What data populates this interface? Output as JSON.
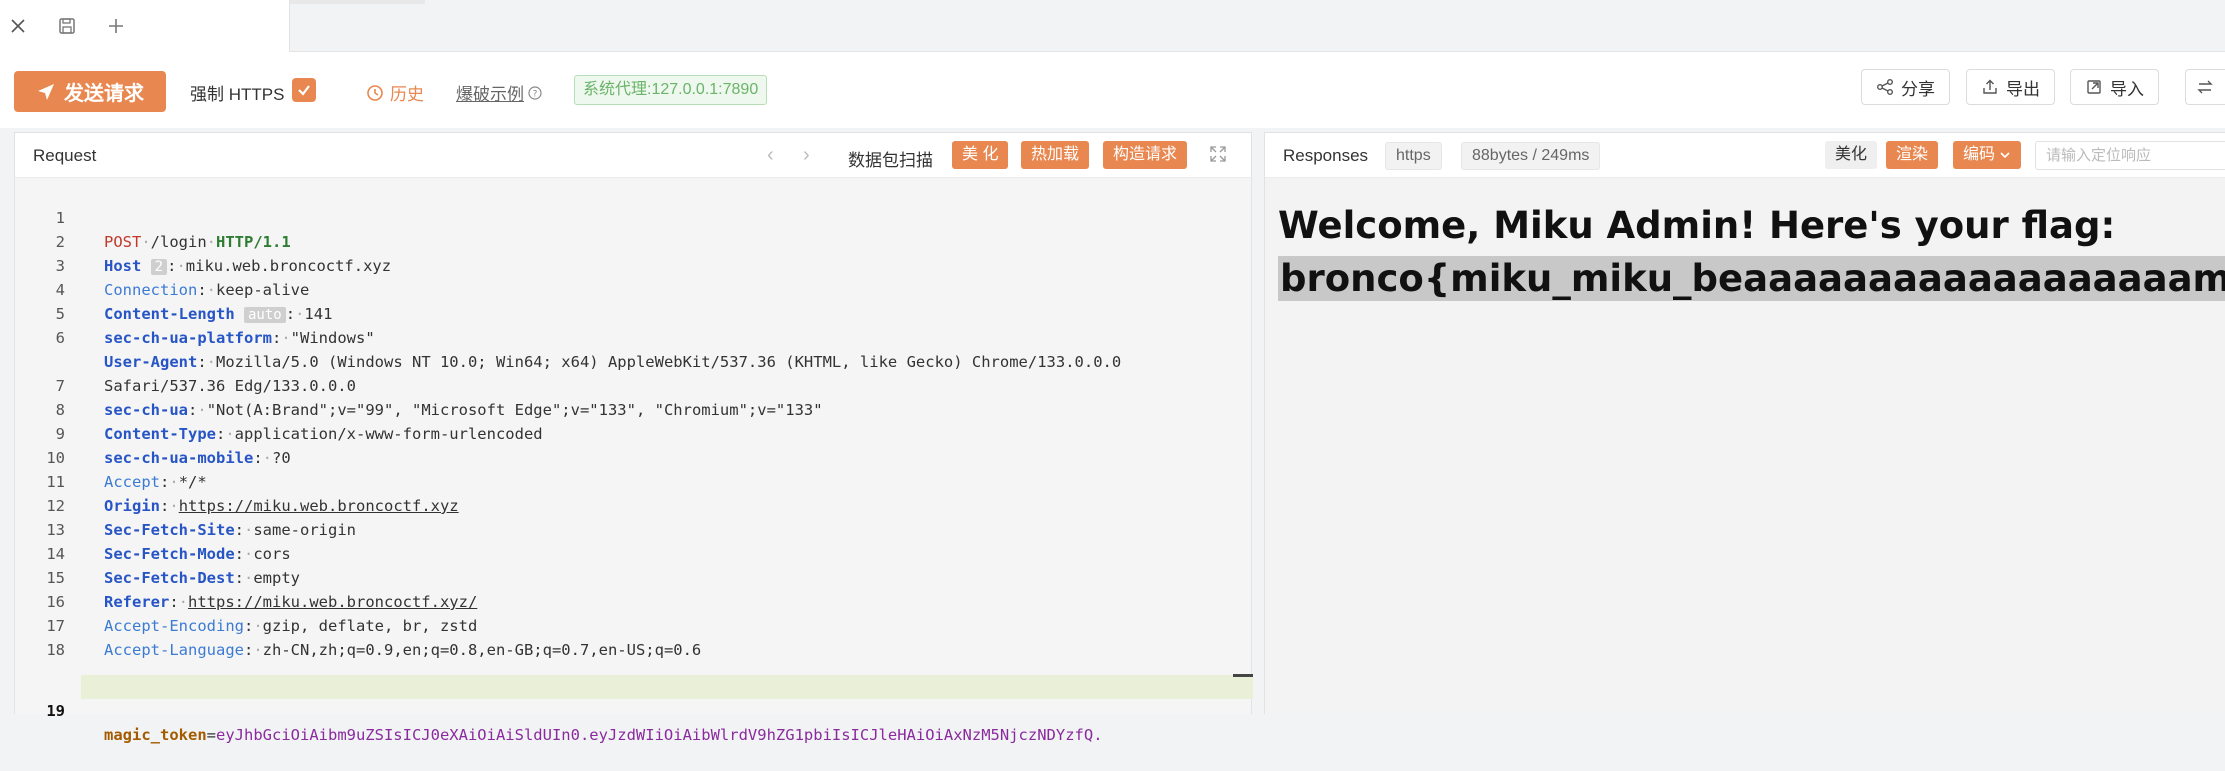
{
  "toolbar": {
    "send_label": "发送请求",
    "https_label": "强制 HTTPS",
    "history_label": "历史",
    "example_label": "爆破示例",
    "proxy_label": "系统代理:127.0.0.1:7890",
    "share_label": "分享",
    "export_label": "导出",
    "import_label": "导入"
  },
  "request": {
    "title": "Request",
    "scan_label": "数据包扫描",
    "beautify_label": "美 化",
    "hotload_label": "热加载",
    "construct_label": "构造请求",
    "lines": [
      {
        "n": "1"
      },
      {
        "n": "2"
      },
      {
        "n": "3"
      },
      {
        "n": "4"
      },
      {
        "n": "5"
      },
      {
        "n": "6"
      },
      {
        "n": ""
      },
      {
        "n": "7"
      },
      {
        "n": "8"
      },
      {
        "n": "9"
      },
      {
        "n": "10"
      },
      {
        "n": "11"
      },
      {
        "n": "12"
      },
      {
        "n": "13"
      },
      {
        "n": "14"
      },
      {
        "n": "15"
      },
      {
        "n": "16"
      },
      {
        "n": "17"
      },
      {
        "n": "18"
      },
      {
        "n": "19"
      }
    ],
    "code": {
      "l1_method": "POST",
      "l1_path": "/login",
      "l1_ver": "HTTP/1.1",
      "l2_key": "Host",
      "l2_pill": "2",
      "l2_val": "miku.web.broncoctf.xyz",
      "l3_key": "Connection",
      "l3_val": "keep-alive",
      "l4_key": "Content-Length",
      "l4_pill": "auto",
      "l4_val": "141",
      "l5_key": "sec-ch-ua-platform",
      "l5_val": "\"Windows\"",
      "l6_key": "User-Agent",
      "l6_val": "Mozilla/5.0 (Windows NT 10.0; Win64; x64) AppleWebKit/537.36 (KHTML, like Gecko) Chrome/133.0.0.0",
      "l6b_val": "Safari/537.36 Edg/133.0.0.0",
      "l7_key": "sec-ch-ua",
      "l7_val": "\"Not(A:Brand\";v=\"99\", \"Microsoft Edge\";v=\"133\", \"Chromium\";v=\"133\"",
      "l8_key": "Content-Type",
      "l8_val": "application/x-www-form-urlencoded",
      "l9_key": "sec-ch-ua-mobile",
      "l9_val": "?0",
      "l10_key": "Accept",
      "l10_val": "*/*",
      "l11_key": "Origin",
      "l11_val": "https://miku.web.broncoctf.xyz",
      "l12_key": "Sec-Fetch-Site",
      "l12_val": "same-origin",
      "l13_key": "Sec-Fetch-Mode",
      "l13_val": "cors",
      "l14_key": "Sec-Fetch-Dest",
      "l14_val": "empty",
      "l15_key": "Referer",
      "l15_val": "https://miku.web.broncoctf.xyz/",
      "l16_key": "Accept-Encoding",
      "l16_val": "gzip, deflate, br, zstd",
      "l17_key": "Accept-Language",
      "l17_val": "zh-CN,zh;q=0.9,en;q=0.8,en-GB;q=0.7,en-US;q=0.6",
      "l19_key": "magic_token",
      "l19_val": "eyJhbGciOiAibm9uZSIsICJ0eXAiOiAiSldUIn0.eyJzdWIiOiAibWlrdV9hZG1pbiIsICJleHAiOiAxNzM5NjczNDYzfQ."
    }
  },
  "response": {
    "title": "Responses",
    "protocol_tag": "https",
    "size_tag": "88bytes / 249ms",
    "beautify_label": "美化",
    "render_label": "渲染",
    "encoding_label": "编码",
    "search_placeholder": "请输入定位响应",
    "heading": "Welcome, Miku Admin! Here's your flag:",
    "flag": "bronco{miku_miku_beaaaaaaaaaaaaaaaaaam!}"
  },
  "colors": {
    "accent": "#e8874f",
    "proxy_green": "#6ab46a"
  }
}
